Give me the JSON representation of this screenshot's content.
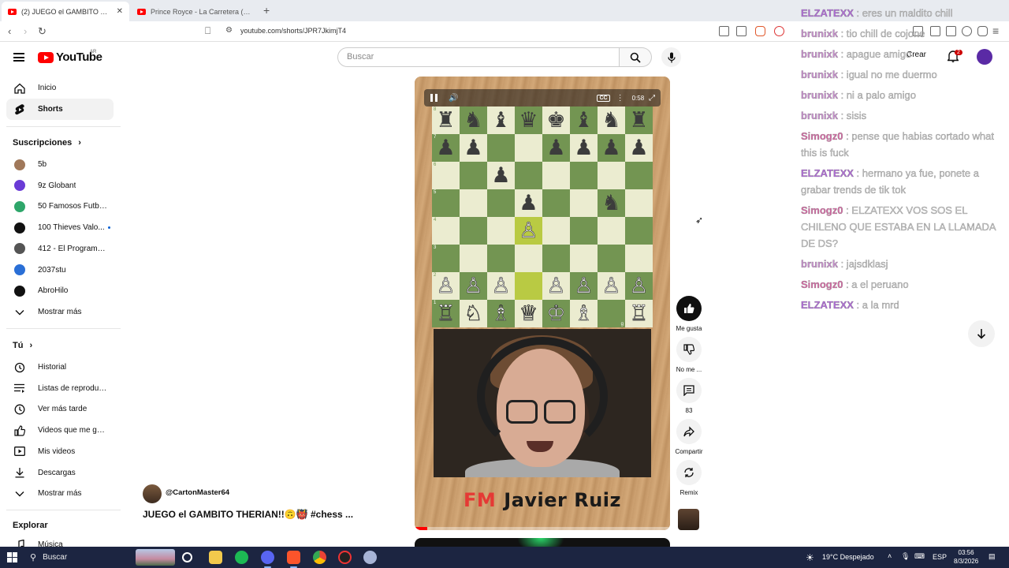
{
  "browser": {
    "tabs": [
      {
        "label": "(2) JUEGO el GAMBITO THERI",
        "active": true
      },
      {
        "label": "Prince Royce - La Carretera (Official V",
        "active": false
      }
    ],
    "url": "youtube.com/shorts/JPR7JkimjT4"
  },
  "masthead": {
    "logo_text": "YouTube",
    "region": "AR",
    "search_placeholder": "Buscar",
    "create_label": "Crear",
    "notif_count": "2"
  },
  "sidebar": {
    "main": [
      {
        "label": "Inicio",
        "icon": "home-icon"
      },
      {
        "label": "Shorts",
        "icon": "shorts-icon",
        "active": true
      }
    ],
    "subs_header": "Suscripciones",
    "subs": [
      {
        "label": "5b",
        "color": "#a0785a"
      },
      {
        "label": "9z Globant",
        "color": "#6a3bd6"
      },
      {
        "label": "50 Famosos Futbol...",
        "color": "#2ea66a"
      },
      {
        "label": "100 Thieves Valo...",
        "color": "#111111",
        "live": true
      },
      {
        "label": "412 - El Programa ...",
        "color": "#555555"
      },
      {
        "label": "2037stu",
        "color": "#2a6fd6"
      },
      {
        "label": "AbroHilo",
        "color": "#111111"
      }
    ],
    "subs_more": "Mostrar más",
    "you_header": "Tú",
    "you": [
      {
        "label": "Historial",
        "icon": "history-icon"
      },
      {
        "label": "Listas de reproducc...",
        "icon": "playlists-icon"
      },
      {
        "label": "Ver más tarde",
        "icon": "watch-later-icon"
      },
      {
        "label": "Videos que me gus...",
        "icon": "liked-videos-icon"
      },
      {
        "label": "Mis videos",
        "icon": "my-videos-icon"
      },
      {
        "label": "Descargas",
        "icon": "downloads-icon"
      }
    ],
    "you_more": "Mostrar más",
    "explore_header": "Explorar",
    "explore": [
      {
        "label": "Música",
        "icon": "music-icon"
      }
    ]
  },
  "short": {
    "player_time": "0:58",
    "nameplate_prefix": "FM",
    "nameplate_name": "Javier Ruiz",
    "progress": 0.05,
    "channel": "@CartonMaster64",
    "title": "JUEGO el GAMBITO THERIAN!!🙃👹 #chess ...",
    "board": [
      [
        "r",
        "n",
        "b",
        "q",
        "k",
        "b",
        "n",
        "r"
      ],
      [
        "p",
        "p",
        "",
        "",
        "p",
        "p",
        "p",
        "p"
      ],
      [
        "",
        "",
        "p",
        "",
        "",
        "",
        "",
        ""
      ],
      [
        "",
        "",
        "",
        "p",
        "",
        "",
        "N",
        ""
      ],
      [
        "",
        "",
        "",
        "P",
        "",
        "",
        "",
        ""
      ],
      [
        "",
        "",
        "",
        "",
        "",
        "",
        "",
        ""
      ],
      [
        "P",
        "P",
        "P",
        "",
        "P",
        "P",
        "P",
        "P"
      ],
      [
        "R",
        "N",
        "B",
        "Q",
        "K",
        "B",
        "",
        "R"
      ]
    ],
    "board_overrides": {
      "3_6": "n",
      "7_6": ""
    },
    "highlights": [
      "4_3",
      "6_3"
    ],
    "rank_labels": [
      "8",
      "7",
      "6",
      "5",
      "4",
      "3",
      "2",
      "1"
    ],
    "file_label_g": "g"
  },
  "actions": {
    "like_label": "Me gusta",
    "dislike_label": "No me ...",
    "comments_count": "83",
    "share_label": "Compartir",
    "remix_label": "Remix"
  },
  "chat": [
    {
      "user": "ELZATEXX",
      "text": ": eres un maldito chill",
      "color": "#b06ad8"
    },
    {
      "user": "brunixk",
      "text": ": tio chill de cojone",
      "color": "#c98fcf"
    },
    {
      "user": "brunixk",
      "text": ": apague amigo",
      "color": "#c98fcf"
    },
    {
      "user": "brunixk",
      "text": ": igual no me duermo",
      "color": "#c98fcf"
    },
    {
      "user": "brunixk",
      "text": ": ni a palo amigo",
      "color": "#c98fcf"
    },
    {
      "user": "brunixk",
      "text": ": sisis",
      "color": "#c98fcf"
    },
    {
      "user": "Simogz0",
      "text": ": pense que habias cortado what this is fuck",
      "color": "#d86aa6"
    },
    {
      "user": "ELZATEXX",
      "text": ": hermano ya fue, ponete a grabar trends de tik tok",
      "color": "#b06ad8"
    },
    {
      "user": "Simogz0",
      "text": ": ELZATEXX VOS SOS EL CHILENO QUE ESTABA EN LA LLAMADA DE DS?",
      "color": "#d86aa6"
    },
    {
      "user": "brunixk",
      "text": ": jajsdklasj",
      "color": "#c98fcf"
    },
    {
      "user": "Simogz0",
      "text": ": a el peruano",
      "color": "#d86aa6"
    },
    {
      "user": "ELZATEXX",
      "text": ": a la mrd",
      "color": "#b06ad8"
    }
  ],
  "taskbar": {
    "search_label": "Buscar",
    "weather": "19°C  Despejado",
    "lang": "ESP",
    "time": "03:56",
    "date": "8/3/2026"
  }
}
